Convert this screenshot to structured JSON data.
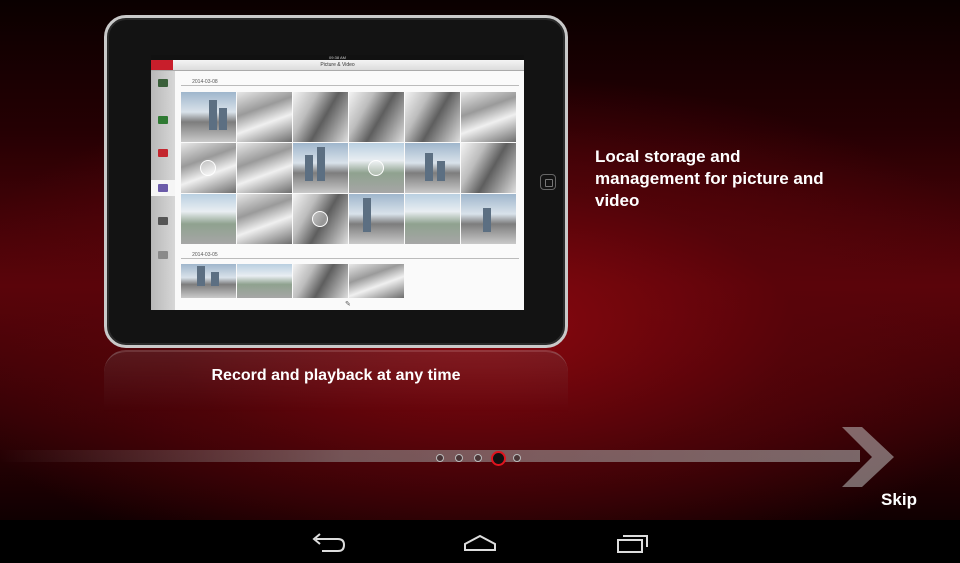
{
  "tablet": {
    "status_time": "09:38 AM",
    "app_title": "Picture & Video",
    "date_group_1": "2014-03-08",
    "date_group_2": "2014-03-05"
  },
  "feature_text": "Local storage and management for picture and video",
  "caption": "Record and playback at any time",
  "pager": {
    "total": 5,
    "active_index": 3
  },
  "skip_label": "Skip",
  "nav": {
    "back_icon": "back-icon",
    "home_icon": "home-icon",
    "recents_icon": "recents-icon"
  },
  "colors": {
    "accent": "#e0141e",
    "background_red": "#5a040a"
  }
}
